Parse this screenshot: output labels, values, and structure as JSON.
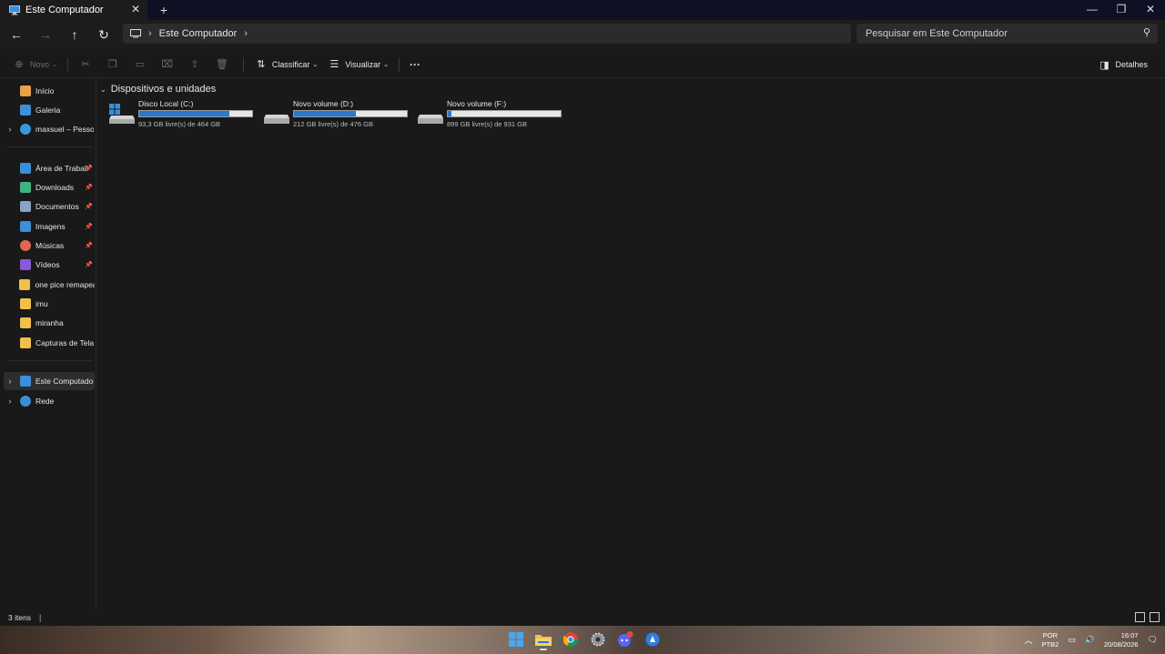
{
  "window": {
    "tab_title": "Este Computador",
    "new_tab": "+",
    "close_tab": "✕",
    "controls": {
      "minimize": "—",
      "maximize": "❐",
      "close": "✕"
    }
  },
  "address": {
    "crumbs": [
      "Este Computador"
    ],
    "search_placeholder": "Pesquisar em Este Computador"
  },
  "toolbar": {
    "new_label": "Novo",
    "sort_label": "Classificar",
    "view_label": "Visualizar",
    "more_label": "···",
    "details_label": "Detalhes"
  },
  "sidebar": {
    "items": [
      {
        "label": "Início",
        "icon": "home-icon",
        "color": "#e8a34a"
      },
      {
        "label": "Galeria",
        "icon": "gallery-icon",
        "color": "#3d8fd6"
      },
      {
        "label": "maxsuel – Pessoal",
        "icon": "onedrive-icon",
        "color": "#3a96dd"
      },
      {
        "label": "Área de Trabalho",
        "icon": "desktop-icon",
        "color": "#3b8fd9"
      },
      {
        "label": "Downloads",
        "icon": "downloads-icon",
        "color": "#3fb37f"
      },
      {
        "label": "Documentos",
        "icon": "documents-icon",
        "color": "#8aa3c4"
      },
      {
        "label": "Imagens",
        "icon": "pictures-icon",
        "color": "#3d8fd6"
      },
      {
        "label": "Músicas",
        "icon": "music-icon",
        "color": "#e1674f"
      },
      {
        "label": "Vídeos",
        "icon": "videos-icon",
        "color": "#8a5ad6"
      },
      {
        "label": "one pice remapead",
        "icon": "folder-icon",
        "color": "#f0c04b"
      },
      {
        "label": "imu",
        "icon": "folder-icon",
        "color": "#f0c04b"
      },
      {
        "label": "miranha",
        "icon": "folder-icon",
        "color": "#f0c04b"
      },
      {
        "label": "Capturas de Tela",
        "icon": "folder-icon",
        "color": "#f0c04b"
      },
      {
        "label": "Este Computador",
        "icon": "this-pc-icon",
        "color": "#3b8fd9"
      },
      {
        "label": "Rede",
        "icon": "network-icon",
        "color": "#3b8fd9"
      }
    ],
    "pin": "📌"
  },
  "main": {
    "group_title": "Dispositivos e unidades",
    "drives": [
      {
        "name": "Disco Local (C:)",
        "free": "93,3 GB livre(s) de 464 GB",
        "used_fraction": 0.8
      },
      {
        "name": "Novo volume (D:)",
        "free": "212 GB livre(s) de 476 GB",
        "used_fraction": 0.55
      },
      {
        "name": "Novo volume (F:)",
        "free": "899 GB livre(s) de 931 GB",
        "used_fraction": 0.035
      }
    ]
  },
  "status": {
    "count": "3 itens",
    "sep": "|"
  },
  "taskbar": {
    "lang_top": "POR",
    "lang_bottom": "PTB2",
    "time": "16:07",
    "date": "20/08/2026"
  }
}
